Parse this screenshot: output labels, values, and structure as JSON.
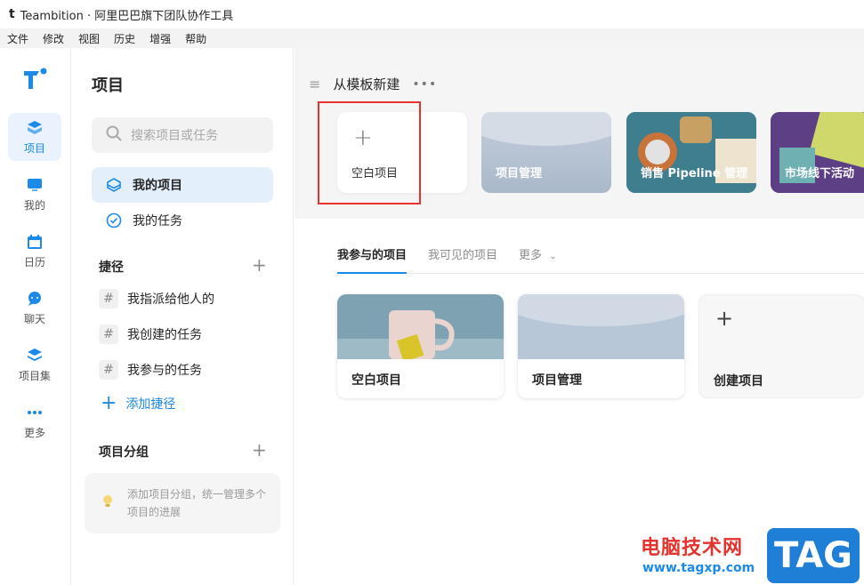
{
  "window": {
    "title": "Teambition · 阿里巴巴旗下团队协作工具"
  },
  "menubar": [
    "文件",
    "修改",
    "视图",
    "历史",
    "增强",
    "帮助"
  ],
  "nav": [
    {
      "label": "项目",
      "icon": "project-icon",
      "active": true
    },
    {
      "label": "我的",
      "icon": "me-icon"
    },
    {
      "label": "日历",
      "icon": "calendar-icon"
    },
    {
      "label": "聊天",
      "icon": "chat-icon"
    },
    {
      "label": "项目集",
      "icon": "layers-icon"
    },
    {
      "label": "更多",
      "icon": "more-icon"
    }
  ],
  "panel": {
    "title": "项目",
    "search_placeholder": "搜索项目或任务",
    "my_projects": "我的项目",
    "my_tasks": "我的任务",
    "shortcuts_title": "捷径",
    "shortcuts": [
      "我指派给他人的",
      "我创建的任务",
      "我参与的任务"
    ],
    "add_shortcut": "添加捷径",
    "groups_title": "项目分组",
    "groups_hint": "添加项目分组，统一管理多个项目的进展"
  },
  "templates": {
    "title": "从模板新建",
    "cards": [
      "空白项目",
      "项目管理",
      "销售 Pipeline 管理",
      "市场线下活动"
    ]
  },
  "tabs": [
    "我参与的项目",
    "我可见的项目",
    "更多"
  ],
  "projects": [
    "空白项目",
    "项目管理",
    "创建项目"
  ],
  "watermark": {
    "cn": "电脑技术网",
    "url": "www.tagxp.com",
    "tag": "TAG"
  },
  "colors": {
    "accent": "#1b8ae8",
    "highlight": "#e5322d"
  }
}
